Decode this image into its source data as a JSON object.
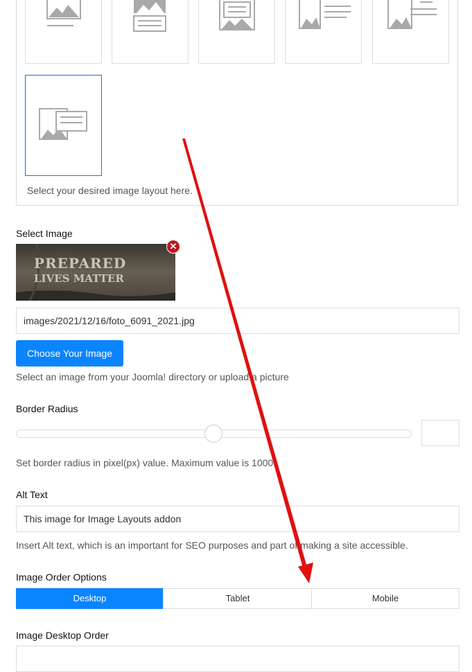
{
  "layout": {
    "help": "Select your desired image layout here.",
    "options": [
      "layout-1",
      "layout-2",
      "layout-3",
      "layout-4",
      "layout-5",
      "layout-6"
    ],
    "selected_index": 5
  },
  "image": {
    "label": "Select Image",
    "thumbnail_line1": "PREPARED",
    "thumbnail_line2": "LIVES MATTER",
    "path": "images/2021/12/16/foto_6091_2021.jpg",
    "choose_button": "Choose Your Image",
    "help": "Select an image from your Joomla! directory or upload a picture"
  },
  "border_radius": {
    "label": "Border Radius",
    "value_fraction": 0.5,
    "help": "Set border radius in pixel(px) value. Maximum value is 1000"
  },
  "alt_text": {
    "label": "Alt Text",
    "value": "This image for Image Layouts addon",
    "help": "Insert Alt text, which is an important for SEO purposes and part of making a site accessible."
  },
  "order_options": {
    "label": "Image Order Options",
    "tabs": [
      "Desktop",
      "Tablet",
      "Mobile"
    ],
    "active": "Desktop"
  },
  "desktop_order": {
    "label": "Image Desktop Order"
  },
  "colors": {
    "accent": "#0a84ff",
    "arrow": "#e01010",
    "icon_gray": "#a9a9a9"
  }
}
